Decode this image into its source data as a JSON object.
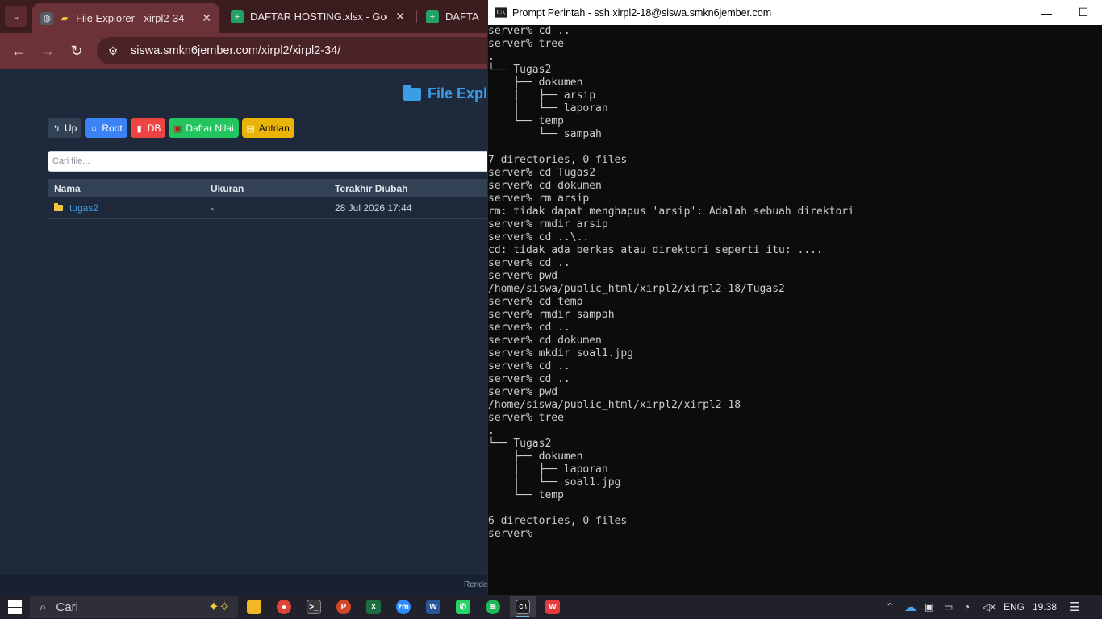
{
  "browser": {
    "tabs": [
      {
        "title": "File Explorer - xirpl2-34",
        "close": "✕"
      },
      {
        "title": "DAFTAR HOSTING.xlsx - Google",
        "close": "✕"
      },
      {
        "title": "DAFTAR H"
      }
    ],
    "url": "siswa.smkn6jember.com/xirpl2/xirpl2-34/"
  },
  "page": {
    "title": "File Expl",
    "buttons": {
      "up": "Up",
      "root": "Root",
      "db": "DB",
      "daftar_nilai": "Daftar Nilai",
      "antrian": "Antrian"
    },
    "search_placeholder": "Cari file...",
    "table": {
      "headers": {
        "name": "Nama",
        "size": "Ukuran",
        "modified": "Terakhir Diubah"
      },
      "rows": [
        {
          "name": "tugas2",
          "size": "-",
          "modified": "28 Jul 2026 17:44"
        }
      ]
    },
    "footer": "Rende"
  },
  "terminal": {
    "title": "Prompt Perintah - ssh  xirpl2-18@siswa.smkn6jember.com",
    "lines": [
      "server% cd ..",
      "server% tree",
      ".",
      "└── Tugas2",
      "    ├── dokumen",
      "    │   ├── arsip",
      "    │   └── laporan",
      "    └── temp",
      "        └── sampah",
      "",
      "7 directories, 0 files",
      "server% cd Tugas2",
      "server% cd dokumen",
      "server% rm arsip",
      "rm: tidak dapat menghapus 'arsip': Adalah sebuah direktori",
      "server% rmdir arsip",
      "server% cd ..\\..",
      "cd: tidak ada berkas atau direktori seperti itu: ....",
      "server% cd ..",
      "server% pwd",
      "/home/siswa/public_html/xirpl2/xirpl2-18/Tugas2",
      "server% cd temp",
      "server% rmdir sampah",
      "server% cd ..",
      "server% cd dokumen",
      "server% mkdir soal1.jpg",
      "server% cd ..",
      "server% cd ..",
      "server% pwd",
      "/home/siswa/public_html/xirpl2/xirpl2-18",
      "server% tree",
      ".",
      "└── Tugas2",
      "    ├── dokumen",
      "    │   ├── laporan",
      "    │   └── soal1.jpg",
      "    └── temp",
      "",
      "6 directories, 0 files",
      "server%"
    ]
  },
  "taskbar": {
    "search_label": "Cari",
    "language": "ENG",
    "time": "19.38"
  }
}
